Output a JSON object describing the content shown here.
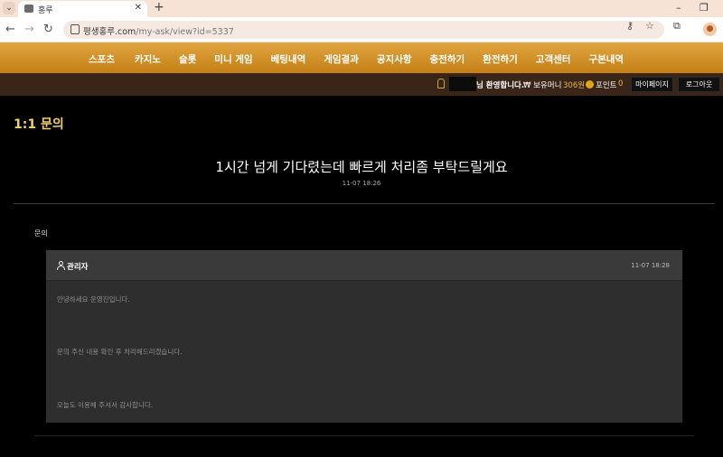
{
  "browser": {
    "tab_title": "홍루",
    "url_host": "평생홍루.com",
    "url_path": "/my-ask/view?id=5337",
    "tab_menu_icon": "chevron-down-icon",
    "new_tab_glyph": "+",
    "minimize_glyph": "–",
    "maximize_glyph": "❐",
    "tab_close_glyph": "✕"
  },
  "nav": {
    "items": [
      "스포츠",
      "카지노",
      "슬롯",
      "미니 게임",
      "베팅내역",
      "게임결과",
      "공지사항",
      "충전하기",
      "환전하기",
      "고객센터",
      "구본내역"
    ]
  },
  "userbar": {
    "welcome": "님 환영합니다.",
    "money_label": "₩ 보유머니",
    "money_value": "306원",
    "point_label": "포인트",
    "point_value": "0",
    "mypage_button": "마이페이지",
    "logout_button": "로그아웃"
  },
  "page": {
    "heading": "1:1 문의",
    "post_title": "1시간 넘게 기다렸는데 빠르게 처리좀 부탁드릴게요",
    "post_date": "11-07 18:26",
    "section_label": "문의"
  },
  "reply": {
    "author": "관리자",
    "date": "11-07 18:28",
    "lines": [
      "안녕하세요 운영진입니다.",
      "문의 주신 내용 확인 후 처리해드리겠습니다.",
      "오늘도 이용해 주셔서 감사합니다."
    ]
  },
  "colors": {
    "nav_gold": "#d8962c",
    "heading_gold": "#f0cf74",
    "userbar_brown": "#3a2618",
    "card_bg": "#2e2e2e"
  }
}
